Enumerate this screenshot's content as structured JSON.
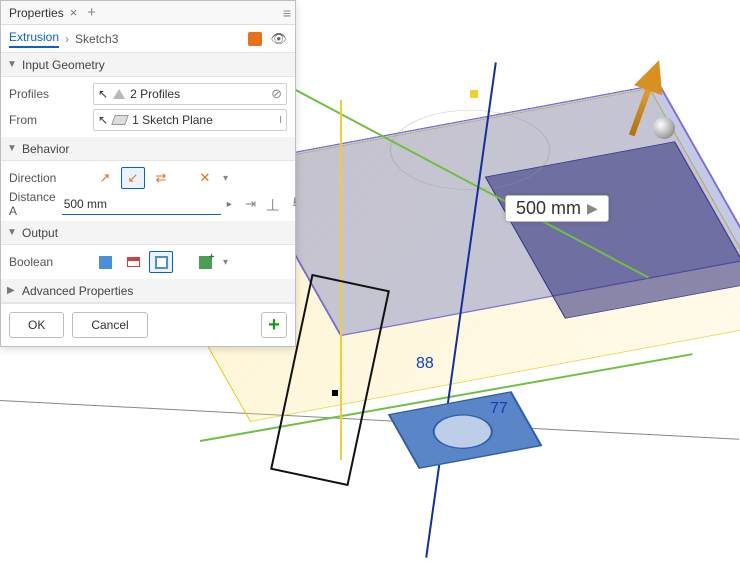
{
  "panel": {
    "title": "Properties",
    "breadcrumb": {
      "active": "Extrusion",
      "next": "Sketch3"
    },
    "sections": {
      "input_geometry": {
        "header": "Input Geometry",
        "rows": {
          "profiles": {
            "label": "Profiles",
            "value": "2 Profiles"
          },
          "from": {
            "label": "From",
            "value": "1 Sketch Plane"
          }
        }
      },
      "behavior": {
        "header": "Behavior",
        "rows": {
          "direction": {
            "label": "Direction",
            "selected_index": 1,
            "options": [
              "default",
              "flip",
              "symmetric",
              "asymmetric"
            ]
          },
          "distance_a": {
            "label": "Distance A",
            "value": "500 mm"
          }
        }
      },
      "output": {
        "header": "Output",
        "rows": {
          "boolean": {
            "label": "Boolean",
            "selected_index": 2,
            "options": [
              "join",
              "cut",
              "intersect",
              "new-solid"
            ]
          }
        }
      },
      "advanced": {
        "header": "Advanced Properties"
      }
    },
    "footer": {
      "ok": "OK",
      "cancel": "Cancel"
    }
  },
  "viewport": {
    "distance_badge": "500 mm",
    "dim_88": "88",
    "dim_77": "77"
  }
}
